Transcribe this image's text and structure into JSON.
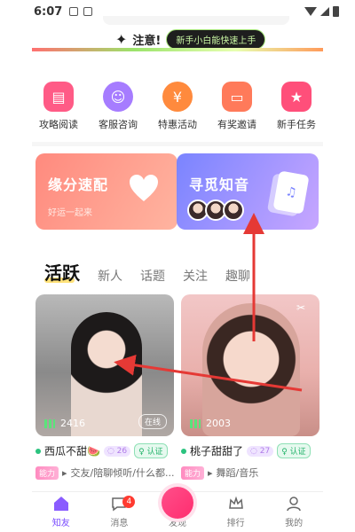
{
  "status_bar": {
    "time": "6:07"
  },
  "banner": {
    "notice": "注意!",
    "pill": "新手小白能快速上手"
  },
  "quick_links": [
    {
      "label": "攻略阅读",
      "icon": "book-icon",
      "color": "#ff5b86"
    },
    {
      "label": "客服咨询",
      "icon": "customer-service-icon",
      "color": "#a67cff"
    },
    {
      "label": "特惠活动",
      "icon": "money-bag-icon",
      "color": "#ff8a3d"
    },
    {
      "label": "有奖邀请",
      "icon": "wallet-icon",
      "color": "#ff7a5a"
    },
    {
      "label": "新手任务",
      "icon": "star-flag-icon",
      "color": "#ff4f7a"
    }
  ],
  "feature_cards": {
    "match": {
      "title": "缘分速配",
      "subtitle": "好运一起来"
    },
    "voice": {
      "title": "寻觅知音"
    }
  },
  "tabs": [
    "活跃",
    "新人",
    "话题",
    "关注",
    "趣聊"
  ],
  "feed": [
    {
      "name": "西瓜不甜🍉",
      "count": "2416",
      "status": "在线",
      "badge_num": "26",
      "verify": "认证",
      "power": "能力",
      "tags": "交友/陪聊倾听/什么都..."
    },
    {
      "name": "桃子甜甜了",
      "count": "2003",
      "badge_num": "27",
      "verify": "认证",
      "power": "能力",
      "tags": "舞蹈/音乐"
    }
  ],
  "nav": [
    {
      "label": "知友",
      "icon": "home-icon"
    },
    {
      "label": "消息",
      "icon": "message-icon",
      "badge": "4"
    },
    {
      "label": "发现",
      "icon": "discover-icon"
    },
    {
      "label": "排行",
      "icon": "crown-icon"
    },
    {
      "label": "我的",
      "icon": "profile-icon"
    }
  ],
  "colors": {
    "accent": "#7b4dff",
    "arrow": "#e53935"
  }
}
